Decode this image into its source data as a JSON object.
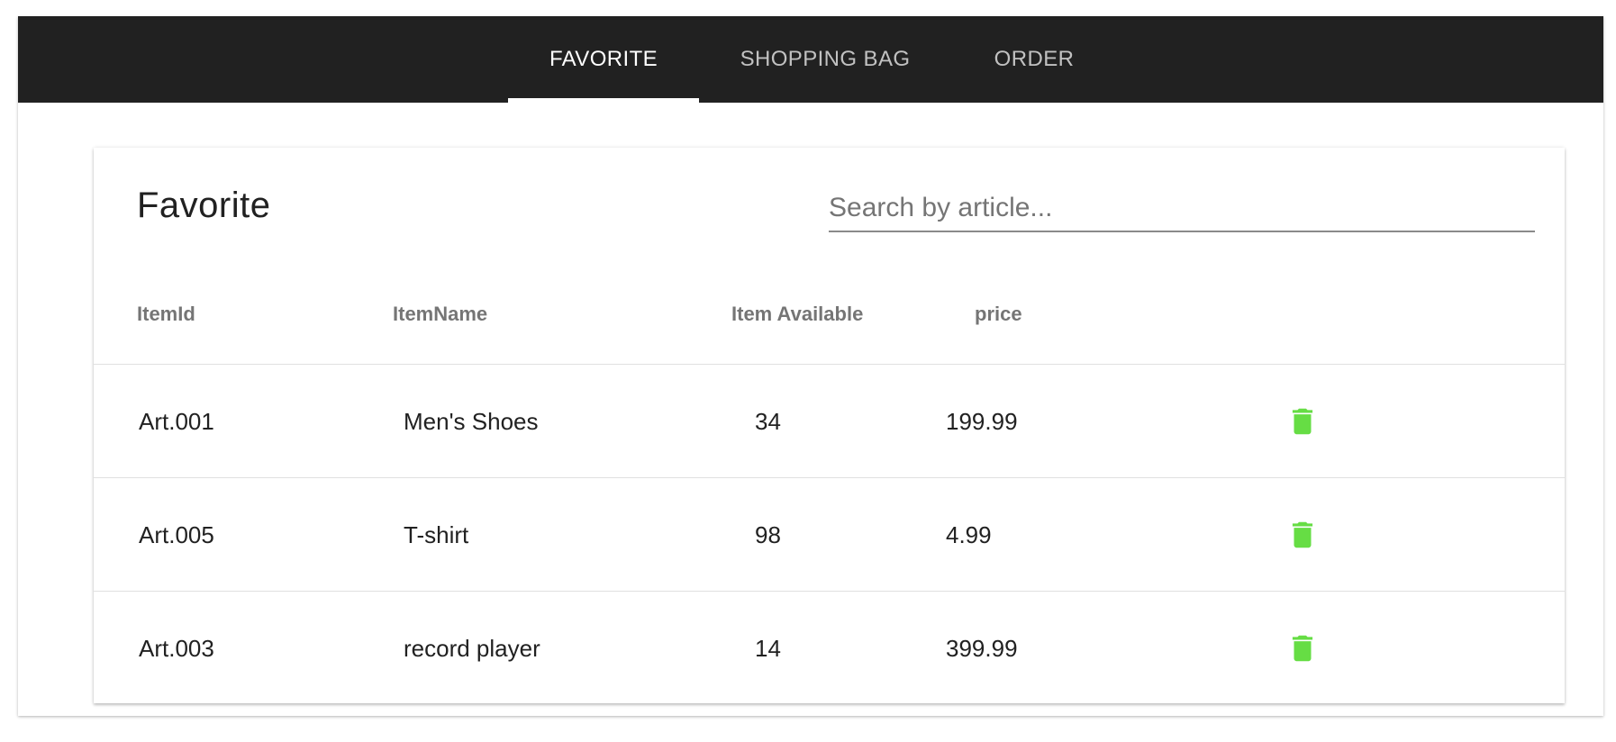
{
  "tabs": [
    {
      "label": "FAVORITE",
      "active": true
    },
    {
      "label": "SHOPPING BAG",
      "active": false
    },
    {
      "label": "ORDER",
      "active": false
    }
  ],
  "card": {
    "title": "Favorite",
    "search_placeholder": "Search by article...",
    "search_value": ""
  },
  "table": {
    "headers": [
      "ItemId",
      "ItemName",
      "Item Available",
      "price"
    ],
    "rows": [
      {
        "id": "Art.001",
        "name": "Men's Shoes",
        "available": "34",
        "price": "199.99",
        "action_icon": "trash-icon"
      },
      {
        "id": "Art.005",
        "name": "T-shirt",
        "available": "98",
        "price": "4.99",
        "action_icon": "trash-icon"
      },
      {
        "id": "Art.003",
        "name": "record player",
        "available": "14",
        "price": "399.99",
        "action_icon": "trash-icon"
      }
    ]
  },
  "colors": {
    "appbar": "#212121",
    "delete_icon": "#66dd44"
  }
}
